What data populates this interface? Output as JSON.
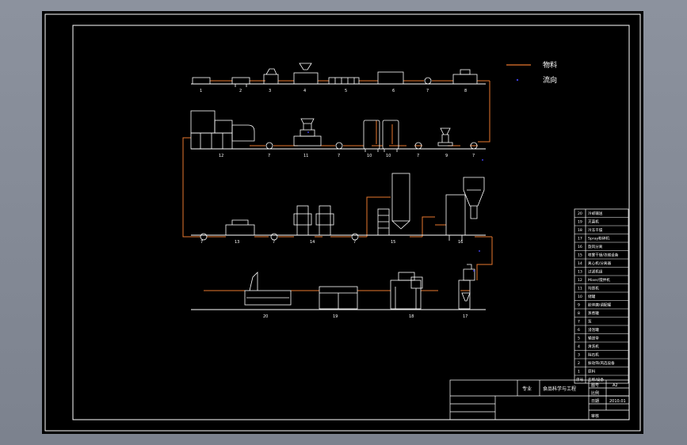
{
  "legend": {
    "material_label": "物料",
    "flow_label": "流向"
  },
  "process_rows": [
    {
      "labels": [
        "1",
        "2",
        "3",
        "4",
        "5",
        "6",
        "7",
        "8"
      ]
    },
    {
      "labels": [
        "12",
        "7",
        "11",
        "7",
        "10",
        "10",
        "7",
        "9",
        "7"
      ]
    },
    {
      "labels": [
        "7",
        "13",
        "7",
        "14",
        "7",
        "15",
        "16"
      ]
    },
    {
      "labels": [
        "20",
        "19",
        "18",
        "17"
      ]
    }
  ],
  "parts_list": {
    "rows": [
      {
        "no": "20",
        "name": "冷却输送"
      },
      {
        "no": "19",
        "name": "灭菌机"
      },
      {
        "no": "18",
        "name": "冷冻干燥"
      },
      {
        "no": "17",
        "name": "Spray粉碎机"
      },
      {
        "no": "16",
        "name": "旋风分离"
      },
      {
        "no": "15",
        "name": "喷雾干燥/浓缩设备"
      },
      {
        "no": "14",
        "name": "离心机/分离器"
      },
      {
        "no": "13",
        "name": "过滤机组"
      },
      {
        "no": "12",
        "name": "Mixer/搅拌机"
      },
      {
        "no": "11",
        "name": "均质机"
      },
      {
        "no": "10",
        "name": "储罐"
      },
      {
        "no": "9",
        "name": "胶体磨/调配罐"
      },
      {
        "no": "8",
        "name": "蒸煮罐"
      },
      {
        "no": "7",
        "name": "泵"
      },
      {
        "no": "6",
        "name": "浸泡罐"
      },
      {
        "no": "5",
        "name": "输送带"
      },
      {
        "no": "4",
        "name": "清洗机"
      },
      {
        "no": "3",
        "name": "除石机"
      },
      {
        "no": "2",
        "name": "振动筛/风选设备"
      },
      {
        "no": "1",
        "name": "原料"
      }
    ],
    "header_no": "序号",
    "header_name": "名称/设备"
  },
  "title_block": {
    "major_label": "专业",
    "major_value": "食品科学与工程",
    "drawing_no_label": "图号",
    "drawing_no_value": "A2",
    "scale_label": "比例",
    "date_label": "日期",
    "date_value": "2010.01",
    "reviewer_label": "审核"
  },
  "colors": {
    "sheet_background": "#000000",
    "frame_lines": "#ffffff",
    "material_line": "#e8772e",
    "flow_marker": "#3b3bdc",
    "viewer_background": "#848a96"
  }
}
